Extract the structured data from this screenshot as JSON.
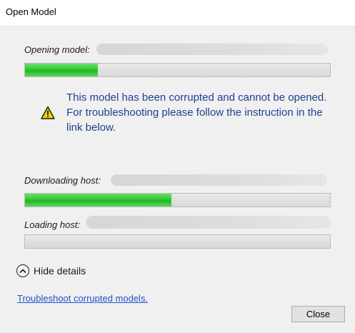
{
  "window": {
    "title": "Open Model"
  },
  "opening": {
    "label": "Opening model:",
    "progress": 0.24
  },
  "warning": {
    "icon": "warning-icon",
    "message": "This model has been corrupted and cannot be opened. For troubleshooting please follow the instruction in the link below."
  },
  "downloading": {
    "label": "Downloading host:",
    "progress": 0.48
  },
  "loading": {
    "label": "Loading host:",
    "progress": 0
  },
  "details_toggle": {
    "label": "Hide details",
    "icon": "chevron-up-icon"
  },
  "link": {
    "label": "Troubleshoot corrupted models."
  },
  "buttons": {
    "close_label": "Close"
  },
  "colors": {
    "message_text": "#1f3f8f",
    "link": "#2050c8",
    "progress_fill": "#2ec92e"
  }
}
